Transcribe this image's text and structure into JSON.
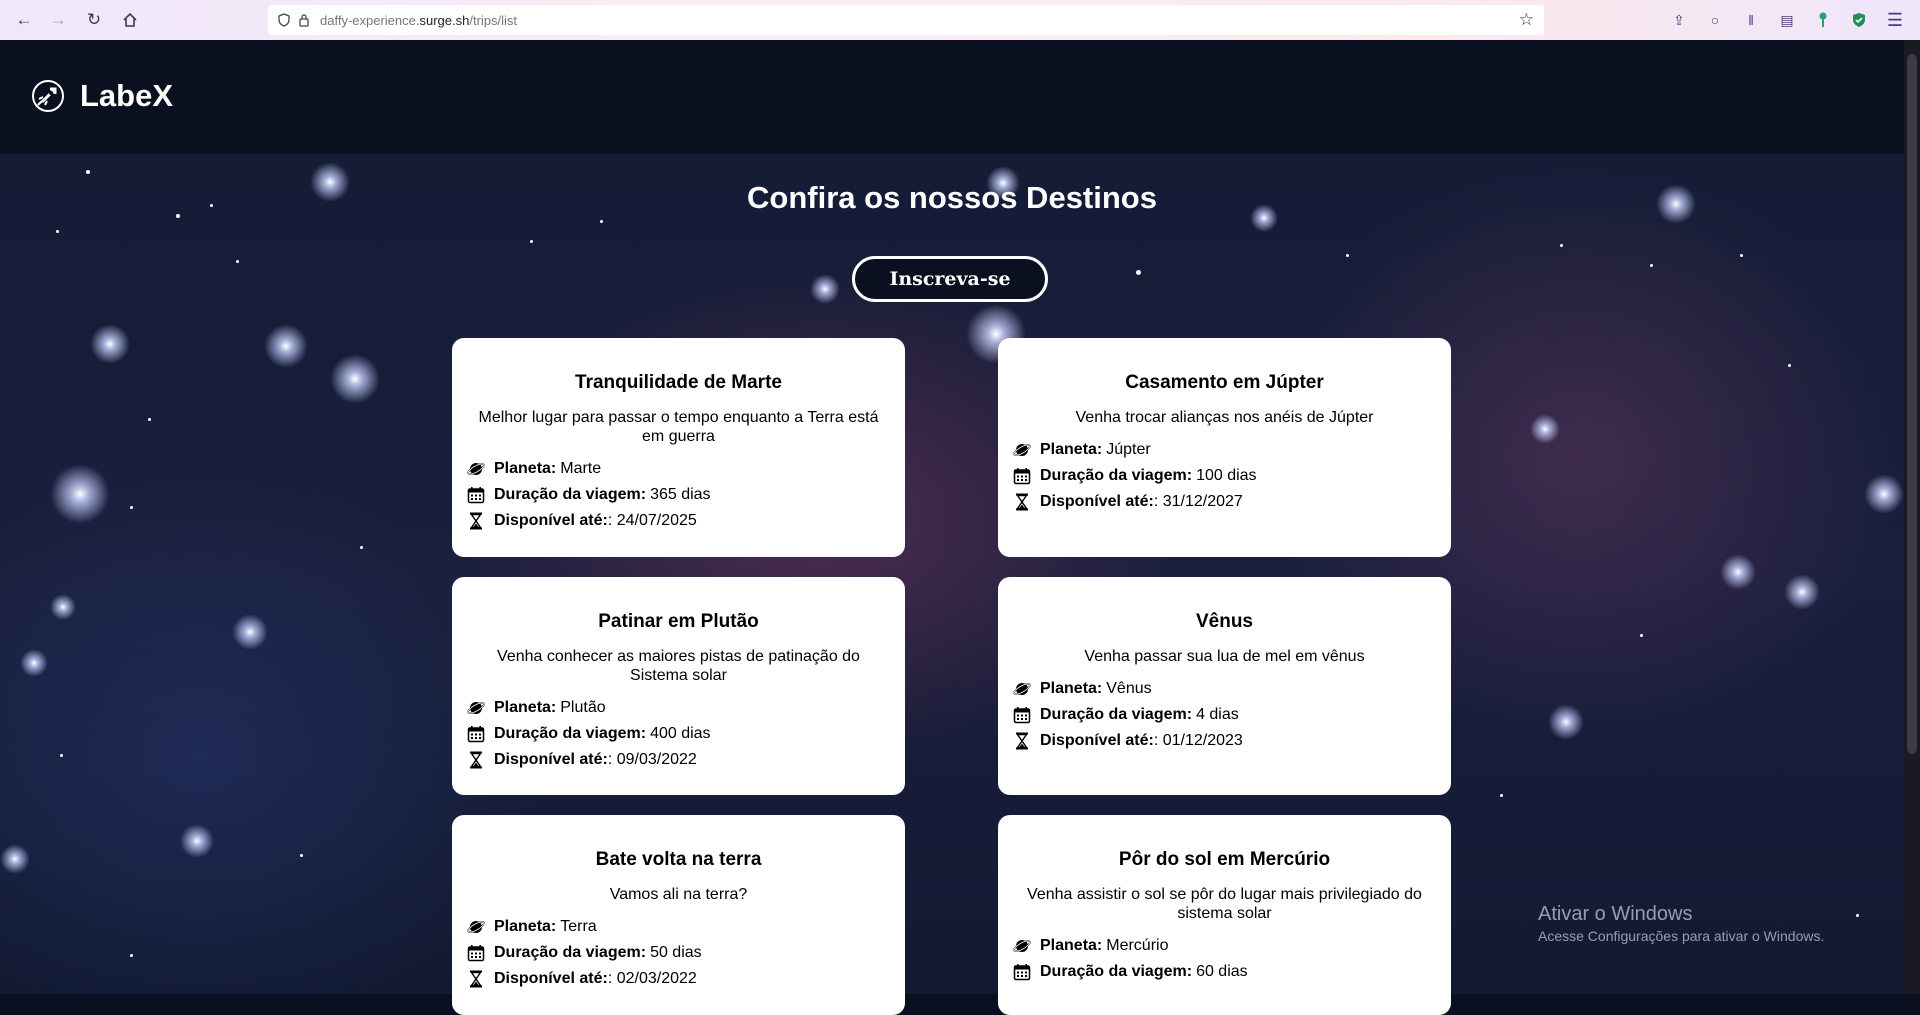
{
  "browser": {
    "url_prefix": "daffy-experience.",
    "url_domain": "surge.sh",
    "url_path": "/trips/list"
  },
  "header": {
    "logo_text": "LabeX"
  },
  "main": {
    "title": "Confira os nossos Destinos",
    "subscribe_label": "Inscreva-se",
    "labels": {
      "planet": "Planeta:",
      "duration": "Duração da viagem:",
      "available": "Disponível até:"
    },
    "trips": [
      {
        "name": "Tranquilidade de Marte",
        "description": "Melhor lugar para passar o tempo enquanto a Terra está em guerra",
        "planet": "Marte",
        "duration": "365 dias",
        "date": ": 24/07/2025"
      },
      {
        "name": "Casamento em Júpter",
        "description": "Venha trocar alianças nos anéis de Júpter",
        "planet": "Júpter",
        "duration": "100 dias",
        "date": ": 31/12/2027"
      },
      {
        "name": "Patinar em Plutão",
        "description": "Venha conhecer as maiores pistas de patinação do Sistema solar",
        "planet": "Plutão",
        "duration": "400 dias",
        "date": ": 09/03/2022"
      },
      {
        "name": "Vênus",
        "description": "Venha passar sua lua de mel em vênus",
        "planet": "Vênus",
        "duration": "4 dias",
        "date": ": 01/12/2023"
      },
      {
        "name": "Bate volta na terra",
        "description": "Vamos ali na terra?",
        "planet": "Terra",
        "duration": "50 dias",
        "date": ": 02/03/2022"
      },
      {
        "name": "Pôr do sol em Mercúrio",
        "description": "Venha assistir o sol se pôr do lugar mais privilegiado do sistema solar",
        "planet": "Mercúrio",
        "duration": "60 dias",
        "date": ""
      }
    ]
  },
  "watermark": {
    "title": "Ativar o Windows",
    "subtitle": "Acesse Configurações para ativar o Windows."
  }
}
